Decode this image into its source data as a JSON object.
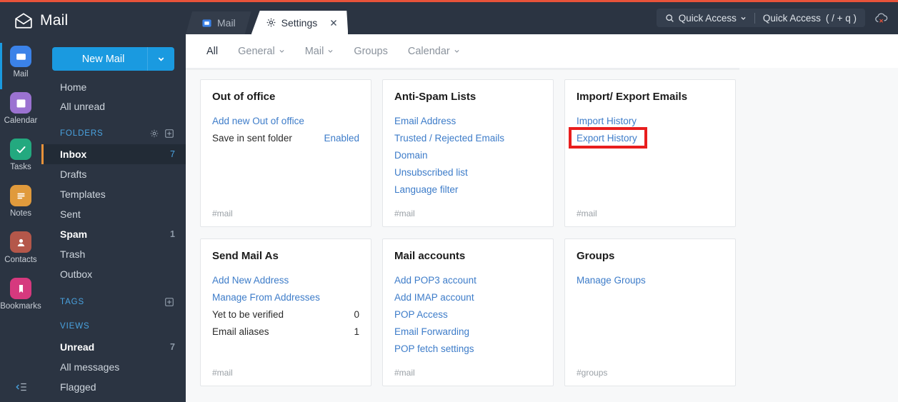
{
  "brand": {
    "title": "Mail",
    "icon": "open-envelope-icon"
  },
  "rail": {
    "items": [
      {
        "label": "Mail",
        "icon": "mail-icon",
        "color": "#3b82e8",
        "active": true
      },
      {
        "label": "Calendar",
        "icon": "calendar-icon",
        "color": "#9b72d1",
        "active": false
      },
      {
        "label": "Tasks",
        "icon": "check-icon",
        "color": "#23a97f",
        "active": false
      },
      {
        "label": "Notes",
        "icon": "notes-icon",
        "color": "#e09a3c",
        "active": false
      },
      {
        "label": "Contacts",
        "icon": "contacts-icon",
        "color": "#b4574a",
        "active": false
      },
      {
        "label": "Bookmarks",
        "icon": "bookmark-icon",
        "color": "#d6397e",
        "active": false
      }
    ]
  },
  "compose": {
    "label": "New Mail",
    "dropdown_icon": "chevron-down-icon"
  },
  "nav_links": [
    {
      "label": "Home"
    },
    {
      "label": "All unread"
    }
  ],
  "folders_section": {
    "title": "FOLDERS",
    "settings_icon": "gear-icon",
    "add_icon": "plus-box-icon",
    "items": [
      {
        "label": "Inbox",
        "count": "7",
        "selected": true,
        "bold": true
      },
      {
        "label": "Drafts",
        "count": "",
        "selected": false,
        "bold": false
      },
      {
        "label": "Templates",
        "count": "",
        "selected": false,
        "bold": false
      },
      {
        "label": "Sent",
        "count": "",
        "selected": false,
        "bold": false
      },
      {
        "label": "Spam",
        "count": "1",
        "selected": false,
        "bold": true
      },
      {
        "label": "Trash",
        "count": "",
        "selected": false,
        "bold": false
      },
      {
        "label": "Outbox",
        "count": "",
        "selected": false,
        "bold": false
      }
    ]
  },
  "tags_section": {
    "title": "TAGS",
    "add_icon": "plus-box-icon"
  },
  "views_section": {
    "title": "VIEWS",
    "items": [
      {
        "label": "Unread",
        "count": "7",
        "bold": true
      },
      {
        "label": "All messages",
        "count": "",
        "bold": false
      },
      {
        "label": "Flagged",
        "count": "",
        "bold": false
      }
    ]
  },
  "collapse_button": {
    "icon": "collapse-sidebar-icon"
  },
  "tabs": [
    {
      "label": "Mail",
      "icon": "mail-tab-icon",
      "active": false,
      "closable": false
    },
    {
      "label": "Settings",
      "icon": "gear-icon",
      "active": true,
      "closable": true,
      "close_icon": "close-icon"
    }
  ],
  "quick_access": {
    "label": "Quick Access",
    "search_icon": "search-icon",
    "chevron_icon": "chevron-down-icon",
    "secondary_label": "Quick Access",
    "shortcut": "( / + q )",
    "cloud_icon": "cloud-offline-icon"
  },
  "filters": [
    {
      "label": "All",
      "active": true,
      "chevron": false
    },
    {
      "label": "General",
      "active": false,
      "chevron": true
    },
    {
      "label": "Mail",
      "active": false,
      "chevron": true
    },
    {
      "label": "Groups",
      "active": false,
      "chevron": false
    },
    {
      "label": "Calendar",
      "active": false,
      "chevron": true
    }
  ],
  "cards": [
    {
      "title": "Out of office",
      "tag": "#mail",
      "rows": [
        {
          "label": "Add new Out of office",
          "value": "",
          "type": "link"
        },
        {
          "label": "Save in sent folder",
          "value": "Enabled",
          "type": "kv",
          "value_accent": true
        }
      ]
    },
    {
      "title": "Anti-Spam Lists",
      "tag": "#mail",
      "rows": [
        {
          "label": "Email Address",
          "value": "",
          "type": "link"
        },
        {
          "label": "Trusted / Rejected Emails",
          "value": "",
          "type": "link"
        },
        {
          "label": "Domain",
          "value": "",
          "type": "link"
        },
        {
          "label": "Unsubscribed list",
          "value": "",
          "type": "link"
        },
        {
          "label": "Language filter",
          "value": "",
          "type": "link"
        }
      ]
    },
    {
      "title": "Import/ Export Emails",
      "tag": "#mail",
      "rows": [
        {
          "label": "Import History",
          "value": "",
          "type": "link"
        },
        {
          "label": "Export History",
          "value": "",
          "type": "link",
          "highlighted": true
        }
      ]
    },
    {
      "title": "Send Mail As",
      "tag": "#mail",
      "rows": [
        {
          "label": "Add New Address",
          "value": "",
          "type": "link"
        },
        {
          "label": "Manage From Addresses",
          "value": "",
          "type": "link"
        },
        {
          "label": "Yet to be verified",
          "value": "0",
          "type": "kv"
        },
        {
          "label": "Email aliases",
          "value": "1",
          "type": "kv"
        }
      ]
    },
    {
      "title": "Mail accounts",
      "tag": "#mail",
      "rows": [
        {
          "label": "Add POP3 account",
          "value": "",
          "type": "link"
        },
        {
          "label": "Add IMAP account",
          "value": "",
          "type": "link"
        },
        {
          "label": "POP Access",
          "value": "",
          "type": "link"
        },
        {
          "label": "Email Forwarding",
          "value": "",
          "type": "link"
        },
        {
          "label": "POP fetch settings",
          "value": "",
          "type": "link"
        }
      ]
    },
    {
      "title": "Groups",
      "tag": "#groups",
      "rows": [
        {
          "label": "Manage Groups",
          "value": "",
          "type": "link"
        }
      ]
    }
  ],
  "annotation": {
    "color": "#e81e1e",
    "target": "Export History"
  },
  "colors": {
    "sidebar_bg": "#2b3442",
    "accent_blue": "#1a9ae0",
    "link_blue": "#3d7cc9",
    "selected_marker": "#e8923a",
    "top_strip": "#e8533a"
  }
}
